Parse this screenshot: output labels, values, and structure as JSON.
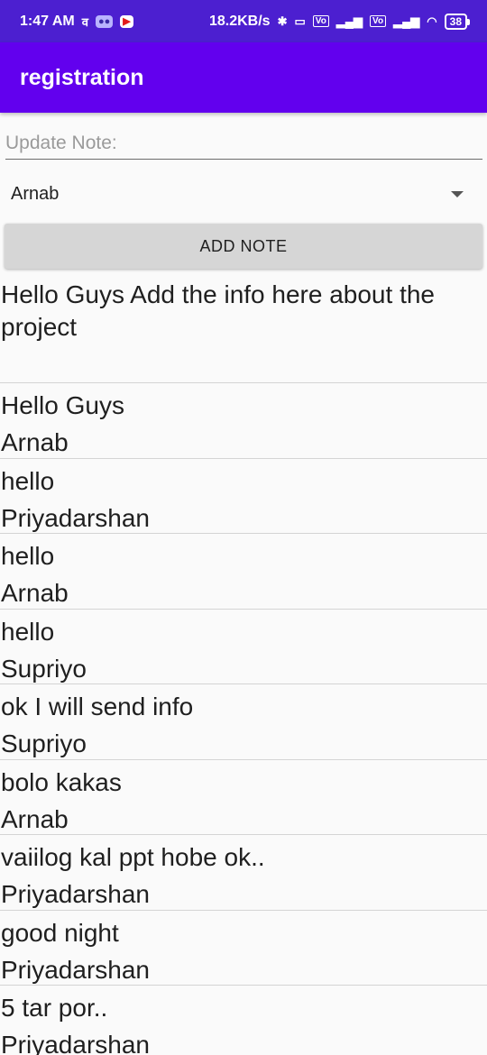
{
  "status_bar": {
    "time": "1:47 AM",
    "net_speed": "18.2KB/s",
    "battery": "38",
    "icons": [
      "notification-icon",
      "discord-icon",
      "youtube-icon",
      "bluetooth-icon",
      "vibrate-icon",
      "volte-icon",
      "signal-icon",
      "wifi-icon",
      "battery-icon"
    ]
  },
  "app_bar": {
    "title": "registration"
  },
  "form": {
    "note_placeholder": "Update Note:",
    "note_value": "",
    "spinner_selected": "Arnab",
    "add_button_label": "ADD NOTE"
  },
  "info_text": "Hello Guys Add the info here about the project",
  "notes": [
    {
      "text": "Hello Guys",
      "author": "Arnab"
    },
    {
      "text": "hello",
      "author": "Priyadarshan"
    },
    {
      "text": "hello",
      "author": "Arnab"
    },
    {
      "text": "hello",
      "author": "Supriyo"
    },
    {
      "text": "ok I will send info",
      "author": "Supriyo"
    },
    {
      "text": "bolo kakas",
      "author": "Arnab"
    },
    {
      "text": "vaiilog kal ppt hobe ok..",
      "author": "Priyadarshan"
    },
    {
      "text": "good night",
      "author": "Priyadarshan"
    },
    {
      "text": "5 tar por..",
      "author": "Priyadarshan"
    }
  ],
  "colors": {
    "status_bar": "#4c1fd0",
    "app_bar": "#6200ee",
    "button_bg": "#d6d6d6",
    "divider": "#d4d4d4"
  }
}
